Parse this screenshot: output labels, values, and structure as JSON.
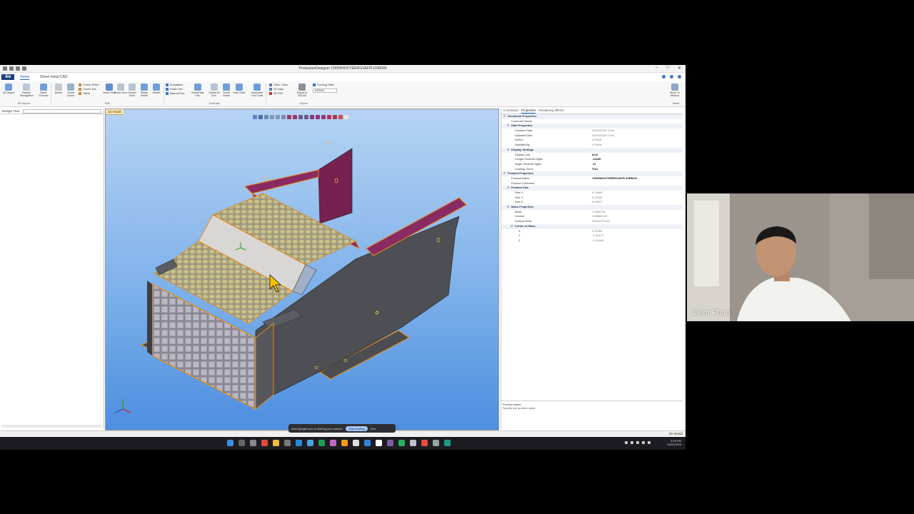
{
  "app": {
    "title": "ProductionDesigner  C0050HOOTERRGVAFPLDSR005",
    "tabs": [
      "Home",
      "Sheet metal CAD"
    ],
    "active_tab": "Home",
    "logo_text": "4ie"
  },
  "ribbon": {
    "buttons": [
      {
        "label": "3D Import"
      },
      {
        "label": "Feature Recognition"
      },
      {
        "label": "Batch Process"
      },
      {
        "label": "Delete"
      },
      {
        "label": "Smart Corner"
      },
      {
        "label": "Insert Hole"
      },
      {
        "label": "Smart Hole"
      },
      {
        "label": "Extract Face"
      },
      {
        "label": "Rotate Unfold"
      },
      {
        "label": "Sketch"
      },
      {
        "label": "Show/Hide Dim."
      },
      {
        "label": "Delete All Dim."
      },
      {
        "label": "Smart Check"
      },
      {
        "label": "Hole Chart"
      },
      {
        "label": "Assemble Tool Chart"
      },
      {
        "label": "Export to 2DCAD"
      },
      {
        "label": "Move To Method"
      }
    ],
    "small_items": {
      "corner_relief": "Corner Relief",
      "corner_ext": "Corner Ext.",
      "offset": "Offset",
      "annotation": "Annotation",
      "radio_dim": "Radio Dim.",
      "manual_dim": "Manual Dim.",
      "ortho_view": "Ortho. View",
      "two_d_data": "2D Data",
      "three_d_pdf": "3D PDF",
      "forming_table": "Forming Table",
      "units_dropdown": "INFRAS"
    },
    "groups": [
      "3D Import",
      "Edit",
      "Evaluate",
      "Export",
      "Mode"
    ]
  },
  "tree_panel": {
    "title": "Design Tree"
  },
  "viewport": {
    "tab_label": "3D Model"
  },
  "properties": {
    "tabs": [
      "Command",
      "Properties",
      "Rendering effects"
    ],
    "active_tab": "Properties",
    "rows": [
      {
        "kind": "cat",
        "level": 0,
        "key": "Document Properties",
        "value": ""
      },
      {
        "kind": "item",
        "level": 1,
        "key": "Customer Name",
        "value": ""
      },
      {
        "kind": "cat",
        "level": 1,
        "key": "Date Properties",
        "value": ""
      },
      {
        "kind": "item",
        "level": 2,
        "key": "Creation Date",
        "value": "10/22/2025 13:04"
      },
      {
        "kind": "item",
        "level": 2,
        "key": "Updated Date",
        "value": "10/22/2025 13:04"
      },
      {
        "kind": "item",
        "level": 2,
        "key": "Author",
        "value": "LPHAN"
      },
      {
        "kind": "item",
        "level": 2,
        "key": "Updated By",
        "value": "LPHAN"
      },
      {
        "kind": "cat",
        "level": 1,
        "key": "Display Settings",
        "value": ""
      },
      {
        "kind": "item",
        "level": 2,
        "key": "Display Unit",
        "value": "Inch",
        "bold": true
      },
      {
        "kind": "item",
        "level": 2,
        "key": "Length Decimal Digits",
        "value": ".12345",
        "bold": true
      },
      {
        "kind": "item",
        "level": 2,
        "key": "Angle Decimal Digits",
        "value": ".12",
        "bold": true
      },
      {
        "kind": "item",
        "level": 2,
        "key": "Leading Zeros",
        "value": "True",
        "bold": true
      },
      {
        "kind": "cat",
        "level": 0,
        "key": "Product Properties",
        "value": ""
      },
      {
        "kind": "item",
        "level": 1,
        "key": "Product Name",
        "value": "C0050HOOTERRGVAFPLDSR005",
        "bold": true
      },
      {
        "kind": "item",
        "level": 1,
        "key": "Product Comment",
        "value": ""
      },
      {
        "kind": "cat",
        "level": 1,
        "key": "Product Size",
        "value": ""
      },
      {
        "kind": "item",
        "level": 2,
        "key": "Size X",
        "value": "5.74865"
      },
      {
        "kind": "item",
        "level": 2,
        "key": "Size Y",
        "value": "4.15333"
      },
      {
        "kind": "item",
        "level": 2,
        "key": "Size Z",
        "value": "6.20847"
      },
      {
        "kind": "cat",
        "level": 1,
        "key": "Mass Properties",
        "value": ""
      },
      {
        "kind": "item",
        "level": 2,
        "key": "Mass",
        "value": "1.26823 lb"
      },
      {
        "kind": "item",
        "level": 2,
        "key": "Volume",
        "value": "4.88668 in3"
      },
      {
        "kind": "item",
        "level": 2,
        "key": "Surface Area",
        "value": "228.53775 in2"
      },
      {
        "kind": "cat",
        "level": 2,
        "key": "Center of Mass",
        "value": ""
      },
      {
        "kind": "item",
        "level": 3,
        "key": "X",
        "value": "0.57384"
      },
      {
        "kind": "item",
        "level": 3,
        "key": "Y",
        "value": "-1.30473"
      },
      {
        "kind": "item",
        "level": 3,
        "key": "Z",
        "value": "-1.12466"
      }
    ],
    "description": {
      "title": "Product Name",
      "text": "Specify the product name."
    }
  },
  "statusbar": {
    "right_text": "3D Model"
  },
  "share_banner": {
    "text": "meet.google.com is sharing your screen.",
    "stop_label": "Stop sharing",
    "hide_label": "Hide"
  },
  "taskbar": {
    "time": "3:05 PM",
    "date": "10/22/2025"
  },
  "participant": {
    "name": "Liem Phan"
  },
  "colors": {
    "magenta_flange": "#8a2a62",
    "body_dark": "#4d4f54",
    "orange_edge": "#e48a1c",
    "perforated": "#b8b49a",
    "viewport_top": "#b6d3f5",
    "viewport_bottom": "#4d8ee0"
  }
}
